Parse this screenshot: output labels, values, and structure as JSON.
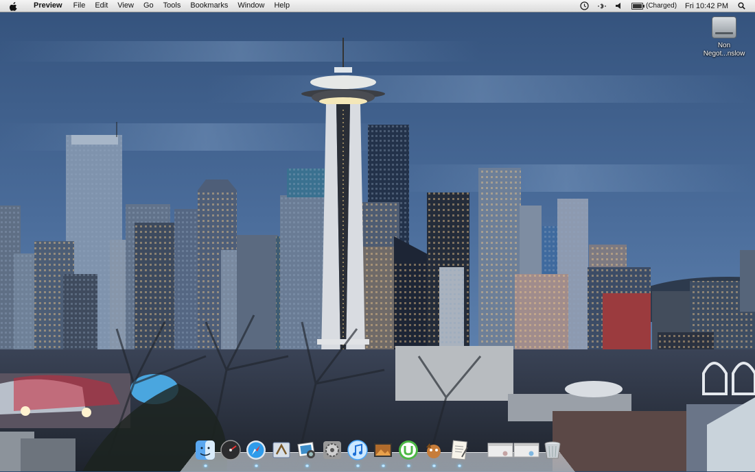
{
  "menubar": {
    "apple_icon": "apple-logo-icon",
    "app_name": "Preview",
    "menus": [
      "File",
      "Edit",
      "View",
      "Go",
      "Tools",
      "Bookmarks",
      "Window",
      "Help"
    ],
    "status": {
      "time_machine_icon": "time-machine-icon",
      "bluetooth_icon": "bluetooth-icon",
      "volume_icon": "volume-icon",
      "battery_icon": "battery-icon",
      "battery_status": "(Charged)",
      "battery_level": 1.0,
      "clock": "Fri 10:42 PM",
      "spotlight_icon": "spotlight-search-icon"
    }
  },
  "desktop": {
    "wallpaper": "Seattle skyline at dusk",
    "disk_icon_label_line1": "Non",
    "disk_icon_label_line2": "Negot...nslow"
  },
  "dock": {
    "items": [
      {
        "name": "finder-icon",
        "color": "#3a8de0"
      },
      {
        "name": "dashboard-icon",
        "color": "#2a2a2a"
      },
      {
        "name": "safari-icon",
        "color": "#2f9bea"
      },
      {
        "name": "mail-icon",
        "color": "#6a7fa3"
      },
      {
        "name": "iphoto-icon",
        "color": "#3e8ec9"
      },
      {
        "name": "system-preferences-icon",
        "color": "#8a8a8a"
      },
      {
        "name": "itunes-icon",
        "color": "#4aa8ff"
      },
      {
        "name": "photo-slideshow-icon",
        "color": "#b06b2c"
      },
      {
        "name": "utorrent-icon",
        "color": "#4cb845"
      },
      {
        "name": "adium-icon",
        "color": "#c77d3a"
      },
      {
        "name": "textedit-icon",
        "color": "#e8e4d6"
      },
      {
        "name": "minimized-window-1-icon",
        "color": "#e4e4e4"
      },
      {
        "name": "minimized-window-2-icon",
        "color": "#e4e4e4"
      },
      {
        "name": "trash-icon",
        "color": "#c9cfd4"
      }
    ]
  },
  "colors": {
    "sky_top": "#3f5f8c",
    "sky_bottom": "#5a7fae",
    "menubar": "#e6e6e6",
    "running_indicator": "#7fd0ff"
  }
}
